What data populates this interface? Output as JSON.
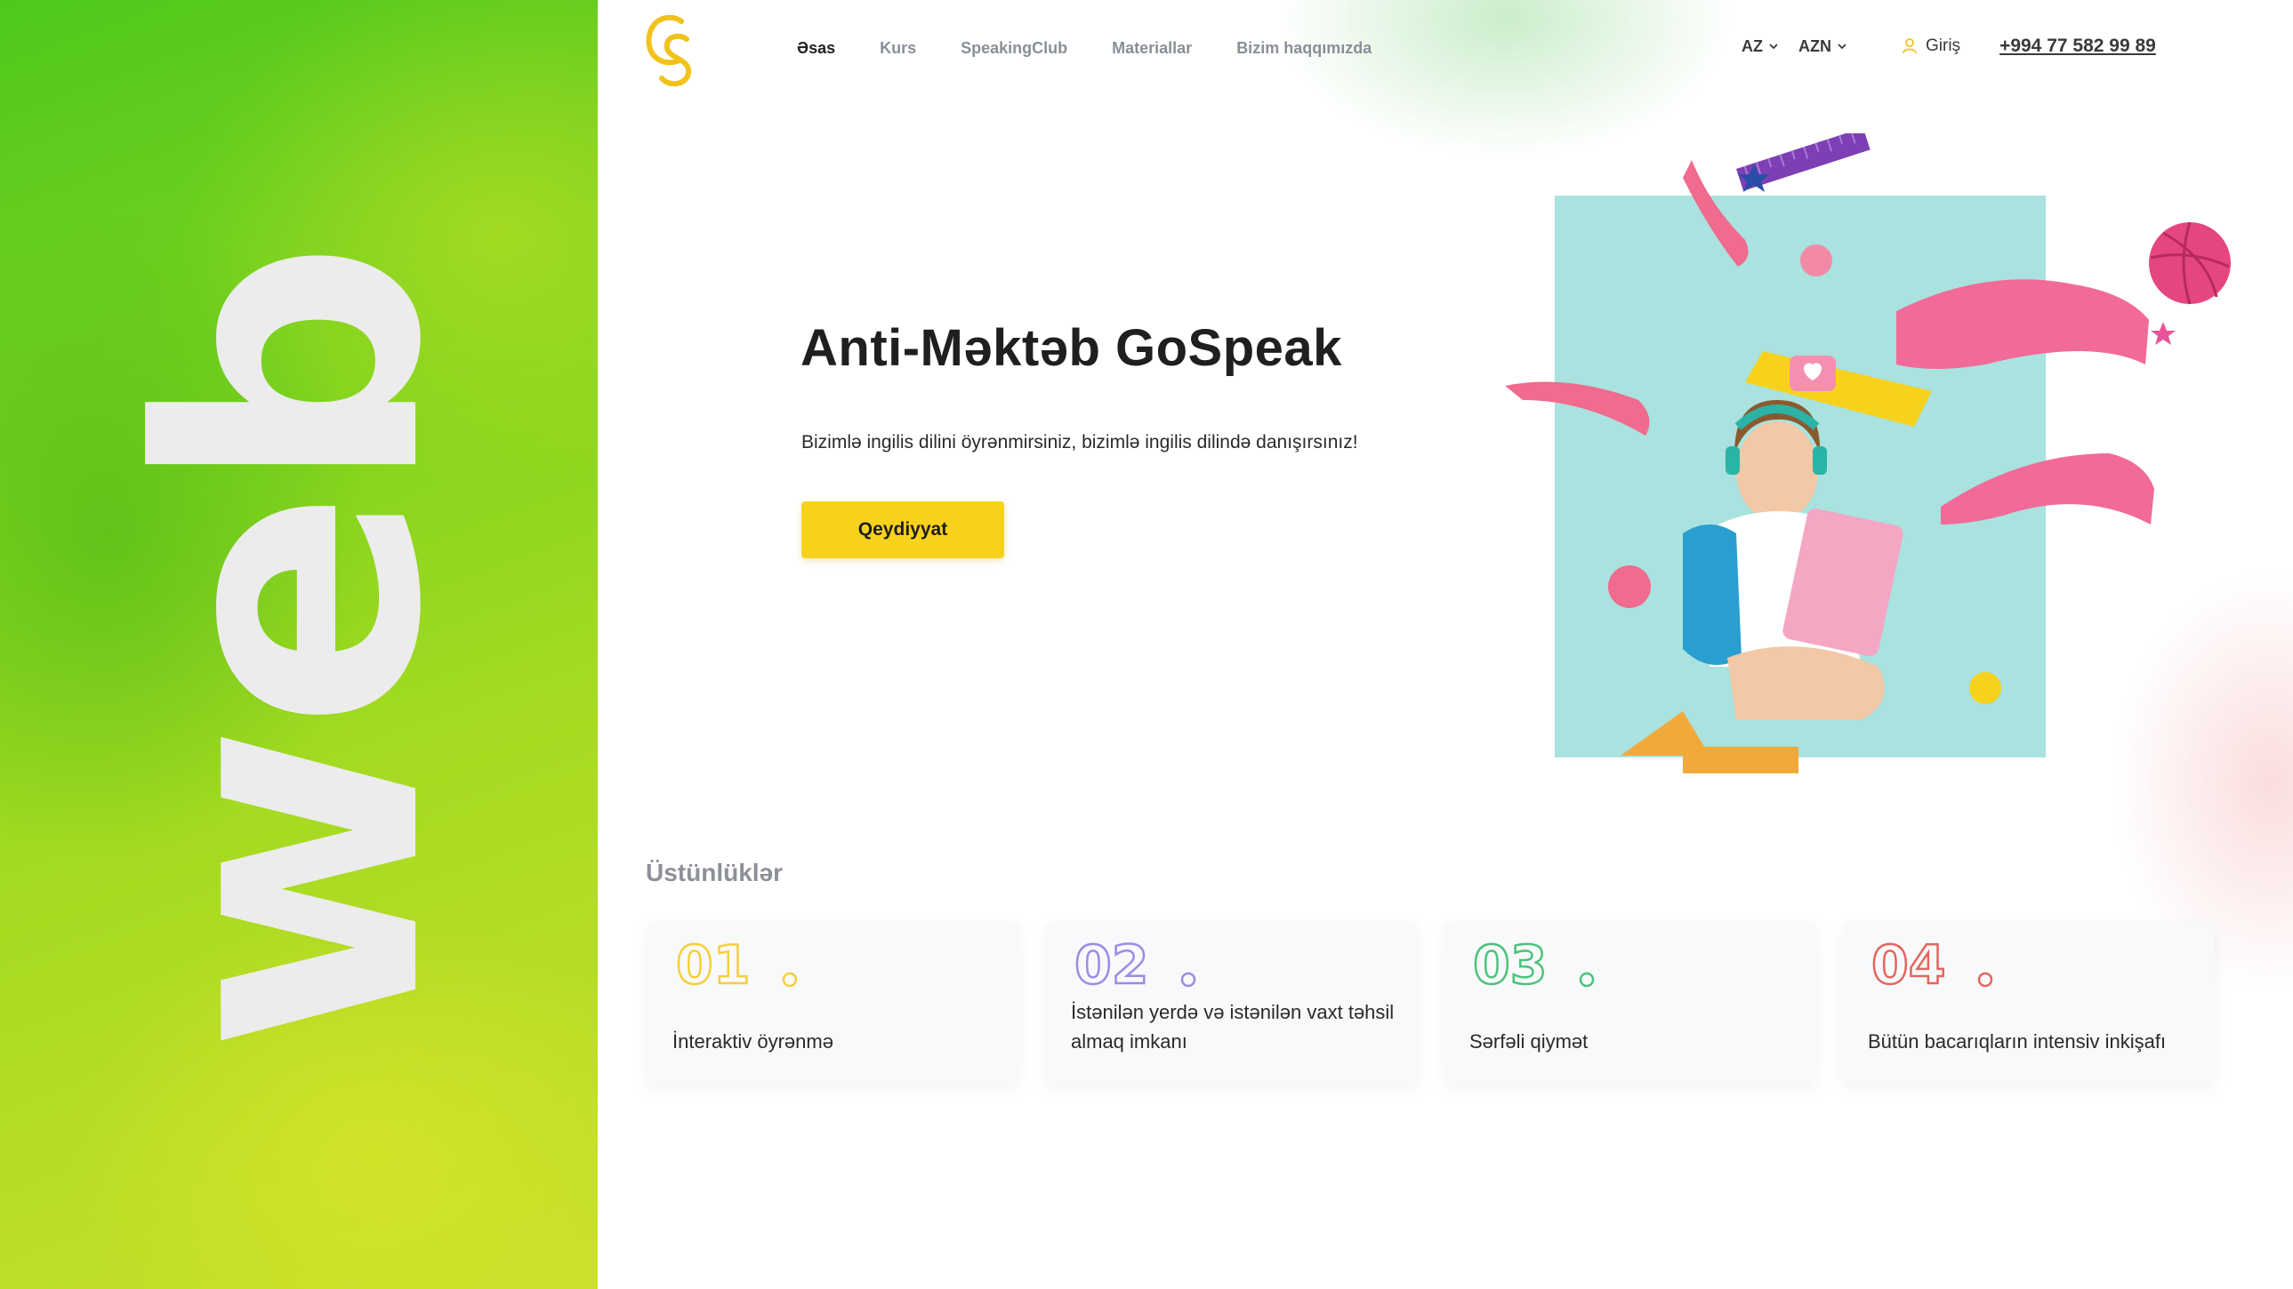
{
  "banner": {
    "word": "web"
  },
  "header": {
    "logo_text": "GS",
    "nav": [
      {
        "label": "Əsas",
        "active": true
      },
      {
        "label": "Kurs",
        "active": false
      },
      {
        "label": "SpeakingClub",
        "active": false
      },
      {
        "label": "Materiallar",
        "active": false
      },
      {
        "label": "Bizim haqqımızda",
        "active": false
      }
    ],
    "language": "AZ",
    "currency": "AZN",
    "login_label": "Giriş",
    "phone": "+994 77 582 99 89"
  },
  "hero": {
    "title": "Anti-Məktəb GoSpeak",
    "subtitle": "Bizimlə ingilis dilini öyrənmirsiniz, bizimlə ingilis dilində danışırsınız!",
    "cta_label": "Qeydiyyat"
  },
  "features": {
    "title": "Üstünlüklər",
    "items": [
      {
        "number": "01",
        "text": "İnteraktiv öyrənmə",
        "color": "#f5cf3a"
      },
      {
        "number": "02",
        "text": "İstənilən yerdə və istənilən vaxt təhsil almaq imkanı",
        "color": "#9a8ce6"
      },
      {
        "number": "03",
        "text": "Sərfəli qiymət",
        "color": "#4cc37a"
      },
      {
        "number": "04",
        "text": "Bütün bacarıqların intensiv inkişafı",
        "color": "#e5655f"
      }
    ]
  },
  "colors": {
    "accent": "#f7d21c",
    "banner_green": "#6fd01e",
    "banner_yellow": "#c9e02a"
  }
}
